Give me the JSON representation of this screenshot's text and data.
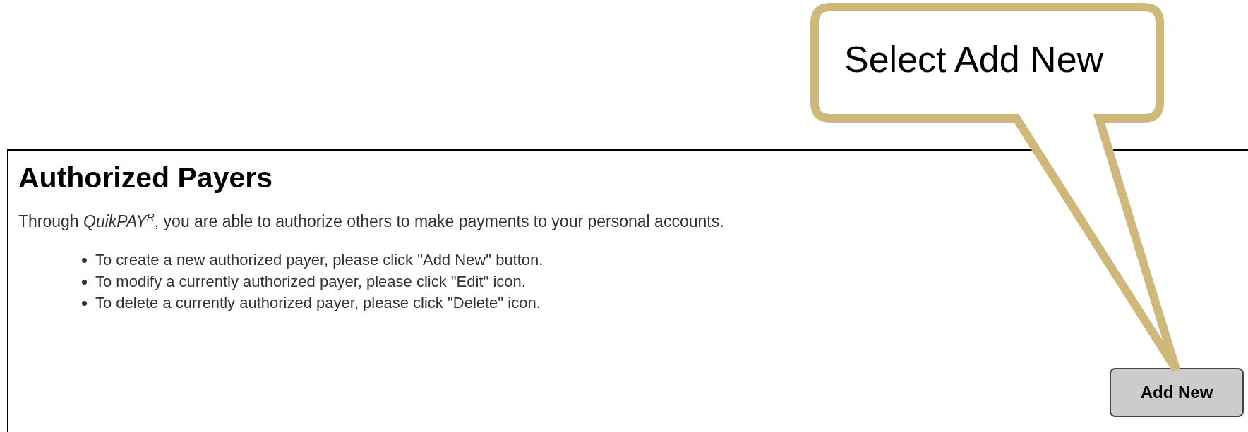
{
  "panel": {
    "title": "Authorized Payers",
    "intro": "Through *QuikPAY*$^{R}$, you are able to authorize others to make payments to your personal accounts.",
    "instructions": [
      "To create a new authorized payer, please click \"Add New\" button.",
      "To modify a currently authorized payer, please click \"Edit\" icon.",
      "To delete a currently authorized payer, please click \"Delete\" icon."
    ],
    "button": "Add New"
  },
  "callout": {
    "text": "Select Add New"
  }
}
